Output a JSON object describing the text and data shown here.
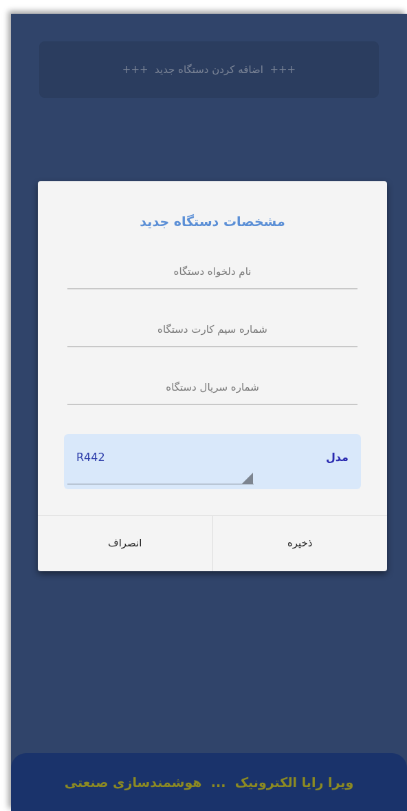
{
  "add_button": {
    "label": "+++  اضافه کردن دستگاه جدید  +++"
  },
  "dialog": {
    "title": "مشخصات دستگاه جدید",
    "fields": [
      {
        "placeholder": "نام دلخواه دستگاه"
      },
      {
        "placeholder": "شماره سیم کارت دستگاه"
      },
      {
        "placeholder": "شماره سریال دستگاه"
      }
    ],
    "model_select": {
      "label": "مدل",
      "value": "R442"
    },
    "buttons": [
      {
        "label": "ذخیره"
      },
      {
        "label": "انصراف"
      }
    ]
  },
  "footer": {
    "text": "ویرا رایا الکترونیک  ...  هوشمندسازی صنعتی"
  }
}
